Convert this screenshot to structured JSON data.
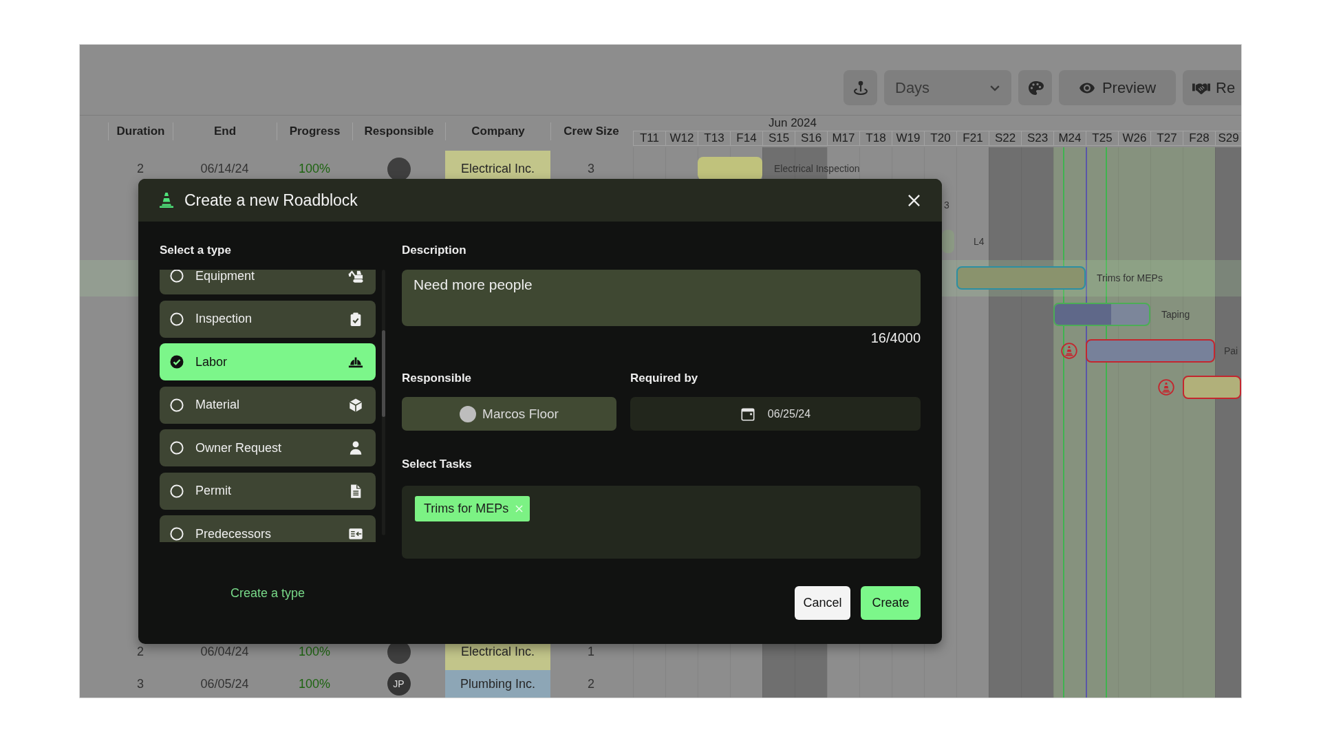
{
  "toolbar": {
    "buttons": [
      {
        "kind": "pin"
      },
      {
        "kind": "dropdown",
        "label": "Days"
      },
      {
        "kind": "palette"
      },
      {
        "kind": "preview",
        "label": "Preview"
      },
      {
        "kind": "handshake",
        "label": "Re"
      }
    ]
  },
  "gantt_header": {
    "month": "Jun 2024",
    "days": [
      {
        "label": "T11",
        "weekend": false,
        "highlighted": false
      },
      {
        "label": "W12",
        "weekend": false,
        "highlighted": false
      },
      {
        "label": "T13",
        "weekend": false,
        "highlighted": false
      },
      {
        "label": "F14",
        "weekend": false,
        "highlighted": false
      },
      {
        "label": "S15",
        "weekend": true,
        "highlighted": false
      },
      {
        "label": "S16",
        "weekend": true,
        "highlighted": false
      },
      {
        "label": "M17",
        "weekend": false,
        "highlighted": false
      },
      {
        "label": "T18",
        "weekend": false,
        "highlighted": false
      },
      {
        "label": "W19",
        "weekend": false,
        "highlighted": false
      },
      {
        "label": "T20",
        "weekend": false,
        "highlighted": false
      },
      {
        "label": "F21",
        "weekend": false,
        "highlighted": false
      },
      {
        "label": "S22",
        "weekend": true,
        "highlighted": false
      },
      {
        "label": "S23",
        "weekend": true,
        "highlighted": false
      },
      {
        "label": "M24",
        "weekend": false,
        "highlighted": true
      },
      {
        "label": "T25",
        "weekend": false,
        "highlighted": true
      },
      {
        "label": "W26",
        "weekend": false,
        "highlighted": true
      },
      {
        "label": "T27",
        "weekend": false,
        "highlighted": true
      },
      {
        "label": "F28",
        "weekend": false,
        "highlighted": true
      },
      {
        "label": "S29",
        "weekend": true,
        "highlighted": false
      }
    ]
  },
  "table": {
    "columns": [
      "Duration",
      "End",
      "Progress",
      "Responsible",
      "Company",
      "Crew Size"
    ],
    "rows": [
      {
        "duration": "2",
        "end": "06/14/24",
        "progress": "100%",
        "responsible": {
          "kind": "photo"
        },
        "company": {
          "name": "Electrical Inc.",
          "color": "#c2c58a"
        },
        "crew_size": "3",
        "bar": {
          "label": "Electrical Inspection",
          "color": "#c0c27c",
          "selected": false,
          "roadblock": false
        }
      },
      {
        "bar": {
          "label": "3"
        }
      },
      {
        "bar": {
          "label": "L4",
          "color": "#8c9a84",
          "selected": false,
          "roadblock": false
        }
      },
      {
        "bar": {
          "label": "Trims for MEPs",
          "color": "#8a936d",
          "selected": true,
          "roadblock": false
        }
      },
      {
        "bar": {
          "label": "Taping",
          "color": "#7c869a",
          "selected": false,
          "roadblock": false,
          "level": 0.6
        }
      },
      {
        "bar": {
          "label": "Pai",
          "color": "#77819a",
          "selected": false,
          "roadblock": true
        }
      },
      {
        "bar": {
          "color": "#b1b07a",
          "selected": false,
          "roadblock": true
        }
      },
      {
        "duration": "2",
        "end": "06/04/24",
        "progress": "100%",
        "responsible": {
          "kind": "photo"
        },
        "company": {
          "name": "Electrical Inc.",
          "color": "#c2c58a"
        },
        "crew_size": "1"
      },
      {
        "duration": "3",
        "end": "06/05/24",
        "progress": "100%",
        "responsible": {
          "kind": "initials",
          "initials": "JP"
        },
        "company": {
          "name": "Plumbing Inc.",
          "color": "#8da6b6"
        },
        "crew_size": "2"
      }
    ]
  },
  "roadblock_dialog": {
    "title": "Create a new Roadblock",
    "type_label": "Select a type",
    "types": [
      {
        "label": "Equipment",
        "kind": "equipment",
        "selected": false
      },
      {
        "label": "Inspection",
        "kind": "inspection",
        "selected": false
      },
      {
        "label": "Labor",
        "kind": "labor",
        "selected": true
      },
      {
        "label": "Material",
        "kind": "material",
        "selected": false
      },
      {
        "label": "Owner Request",
        "kind": "owner",
        "selected": false
      },
      {
        "label": "Permit",
        "kind": "permit",
        "selected": false
      },
      {
        "label": "Predecessors",
        "kind": "predecessors",
        "selected": false
      }
    ],
    "create_type_link": "Create a type",
    "description_label": "Description",
    "description": "Need more people",
    "counter": "16/4000",
    "responsible_label": "Responsible",
    "responsible": "Marcos Floor",
    "required_by_label": "Required by",
    "required_by": "06/25/24",
    "tasks_label": "Select Tasks",
    "tasks": [
      "Trims for MEPs"
    ],
    "buttons": [
      {
        "kind": "cancel",
        "label": "Cancel"
      },
      {
        "kind": "create",
        "label": "Create"
      }
    ]
  }
}
